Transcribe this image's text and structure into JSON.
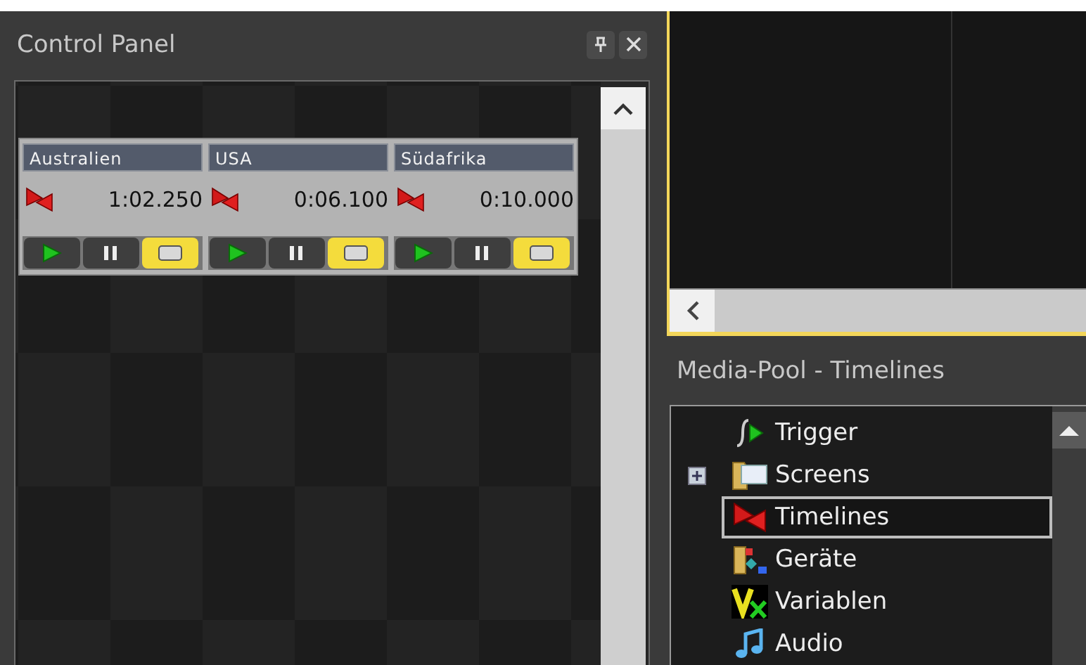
{
  "control_panel": {
    "title": "Control Panel",
    "timelines": [
      {
        "name": "Australien",
        "time": "1:02.250",
        "buttons": [
          {
            "kind": "play",
            "active": false
          },
          {
            "kind": "pause",
            "active": false
          },
          {
            "kind": "stop",
            "active": true
          }
        ]
      },
      {
        "name": "USA",
        "time": "0:06.100",
        "buttons": [
          {
            "kind": "play",
            "active": false
          },
          {
            "kind": "pause",
            "active": false
          },
          {
            "kind": "stop",
            "active": true
          }
        ]
      },
      {
        "name": "Südafrika",
        "time": "0:10.000",
        "buttons": [
          {
            "kind": "play",
            "active": false
          },
          {
            "kind": "pause",
            "active": false
          },
          {
            "kind": "stop",
            "active": true
          }
        ]
      }
    ]
  },
  "media_pool": {
    "title": "Media-Pool - Timelines",
    "items": [
      {
        "label": "Trigger",
        "kind": "trigger",
        "selected": false
      },
      {
        "label": "Screens",
        "kind": "screens",
        "selected": false,
        "expanded": false
      },
      {
        "label": "Timelines",
        "kind": "timelines",
        "selected": true
      },
      {
        "label": "Geräte",
        "kind": "devices",
        "selected": false
      },
      {
        "label": "Variablen",
        "kind": "variables",
        "selected": false
      },
      {
        "label": "Audio",
        "kind": "audio",
        "selected": false
      }
    ]
  }
}
